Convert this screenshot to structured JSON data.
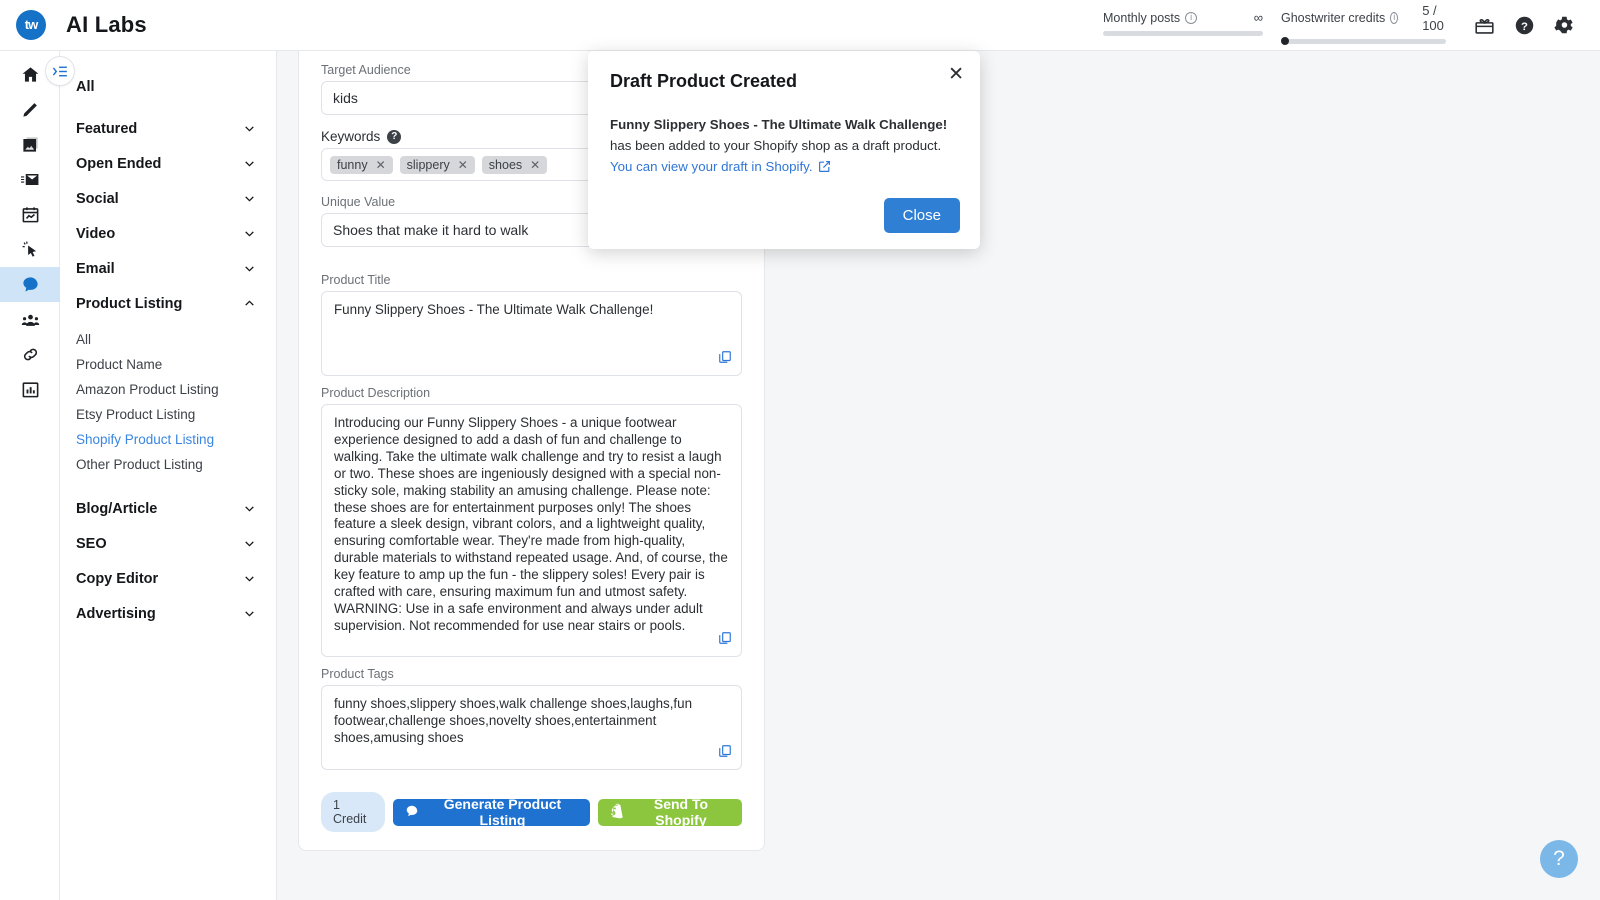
{
  "header": {
    "logo_text": "tw",
    "title": "AI Labs",
    "meters": [
      {
        "label": "Monthly posts",
        "value": "∞",
        "fill_percent": 0,
        "dot": false
      },
      {
        "label": "Ghostwriter credits",
        "value": "5 / 100",
        "fill_percent": 5,
        "dot": true
      }
    ],
    "icons": [
      {
        "name": "gift-icon"
      },
      {
        "name": "help-circle-icon"
      },
      {
        "name": "gear-icon"
      }
    ]
  },
  "rail": {
    "items": [
      {
        "name": "home-icon",
        "active": false
      },
      {
        "name": "pen-icon",
        "active": false
      },
      {
        "name": "image-icon",
        "active": false
      },
      {
        "name": "email-icon",
        "active": false
      },
      {
        "name": "calendar-icon",
        "active": false
      },
      {
        "name": "click-cursor-icon",
        "active": false
      },
      {
        "name": "chat-bubble-icon",
        "active": true
      },
      {
        "name": "people-icon",
        "active": false
      },
      {
        "name": "link-icon",
        "active": false
      },
      {
        "name": "bar-chart-icon",
        "active": false
      }
    ],
    "toggle_name": "sidebar-toggle"
  },
  "sidebar": {
    "all_label": "All",
    "groups": [
      {
        "label": "Featured",
        "expanded": false
      },
      {
        "label": "Open Ended",
        "expanded": false
      },
      {
        "label": "Social",
        "expanded": false
      },
      {
        "label": "Video",
        "expanded": false
      },
      {
        "label": "Email",
        "expanded": false
      },
      {
        "label": "Product Listing",
        "expanded": true
      },
      {
        "label": "Blog/Article",
        "expanded": false
      },
      {
        "label": "SEO",
        "expanded": false
      },
      {
        "label": "Copy Editor",
        "expanded": false
      },
      {
        "label": "Advertising",
        "expanded": false
      }
    ],
    "product_listing_items": [
      {
        "label": "All",
        "selected": false
      },
      {
        "label": "Product Name",
        "selected": false
      },
      {
        "label": "Amazon Product Listing",
        "selected": false
      },
      {
        "label": "Etsy Product Listing",
        "selected": false
      },
      {
        "label": "Shopify Product Listing",
        "selected": true
      },
      {
        "label": "Other Product Listing",
        "selected": false
      }
    ]
  },
  "form": {
    "target_audience": {
      "label": "Target Audience",
      "value": "kids"
    },
    "keywords": {
      "label": "Keywords",
      "chips": [
        "funny",
        "slippery",
        "shoes"
      ]
    },
    "unique_value": {
      "label": "Unique Value",
      "value": "Shoes that make it hard to walk"
    },
    "product_title": {
      "label": "Product Title",
      "value": "Funny Slippery Shoes - The Ultimate Walk Challenge!"
    },
    "product_description": {
      "label": "Product Description",
      "value": "Introducing our Funny Slippery Shoes - a unique footwear experience designed to add a dash of fun and challenge to walking. Take the ultimate walk challenge and try to resist a laugh or two. These shoes are ingeniously designed with a special non-sticky sole, making stability an amusing challenge. Please note: these shoes are for entertainment purposes only! The shoes feature a sleek design, vibrant colors, and a lightweight quality, ensuring comfortable wear. They're made from high-quality, durable materials to withstand repeated usage. And, of course, the key feature to amp up the fun - the slippery soles! Every pair is crafted with care, ensuring maximum fun and utmost safety. WARNING: Use in a safe environment and always under adult supervision. Not recommended for use near stairs or pools."
    },
    "product_tags": {
      "label": "Product Tags",
      "value": "funny shoes,slippery shoes,walk challenge shoes,laughs,fun footwear,challenge shoes,novelty shoes,entertainment shoes,amusing shoes"
    },
    "actions": {
      "credit_pill": "1 Credit",
      "generate_label": "Generate Product Listing",
      "send_label": "Send To Shopify"
    }
  },
  "modal": {
    "title": "Draft Product Created",
    "body_bold": "Funny Slippery Shoes - The Ultimate Walk Challenge!",
    "body_text": " has been added to your Shopify shop as a draft product. ",
    "body_link": "You can view your draft in Shopify.",
    "close_label": "Close"
  },
  "fab": {
    "label": "?"
  },
  "colors": {
    "accent_blue": "#1f72cf",
    "shopify_green": "#8cc63f",
    "link_blue": "#2f76d6",
    "active_rail": "#cfe4f7"
  }
}
